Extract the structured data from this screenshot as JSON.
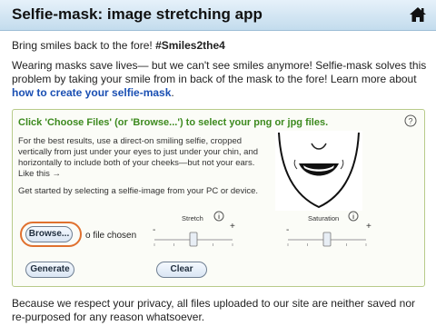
{
  "header": {
    "title": "Selfie-mask: image stretching app",
    "home_icon": "home-icon"
  },
  "intro": {
    "line1_prefix": "Bring smiles back to the fore! ",
    "hashtag": "#Smiles2the4",
    "line2_text": "Wearing masks save lives— but we can't see smiles anymore! Selfie-mask solves this problem by taking your smile from in back of the mask to the fore! Learn more about ",
    "learn_more_link": "how to create your selfie-mask",
    "line2_suffix": "."
  },
  "panel": {
    "title": "Click 'Choose Files' (or 'Browse...') to select your png or jpg files.",
    "help_icon": "help-icon",
    "instructions": "For the best results, use a direct-on smiling selfie, cropped vertically from just under your eyes to just under your chin, and horizontally to include both of your cheeks—but not your ears. Like this →",
    "instructions2": "Get started by selecting a selfie-image from your PC or device.",
    "browse_label": "Browse...",
    "no_file_text": "o file chosen",
    "generate_label": "Generate",
    "clear_label": "Clear",
    "stretch": {
      "label": "Stretch",
      "minus": "-",
      "plus": "+",
      "value_fraction": 0.5
    },
    "saturation": {
      "label": "Saturation",
      "minus": "-",
      "plus": "+",
      "value_fraction": 0.5
    },
    "accent_color": "#3d8a1f",
    "highlight_color": "#e0712f"
  },
  "footer": {
    "privacy": "Because we respect your privacy, all files uploaded to our site are neither saved nor re-purposed for any reason whatsoever."
  }
}
